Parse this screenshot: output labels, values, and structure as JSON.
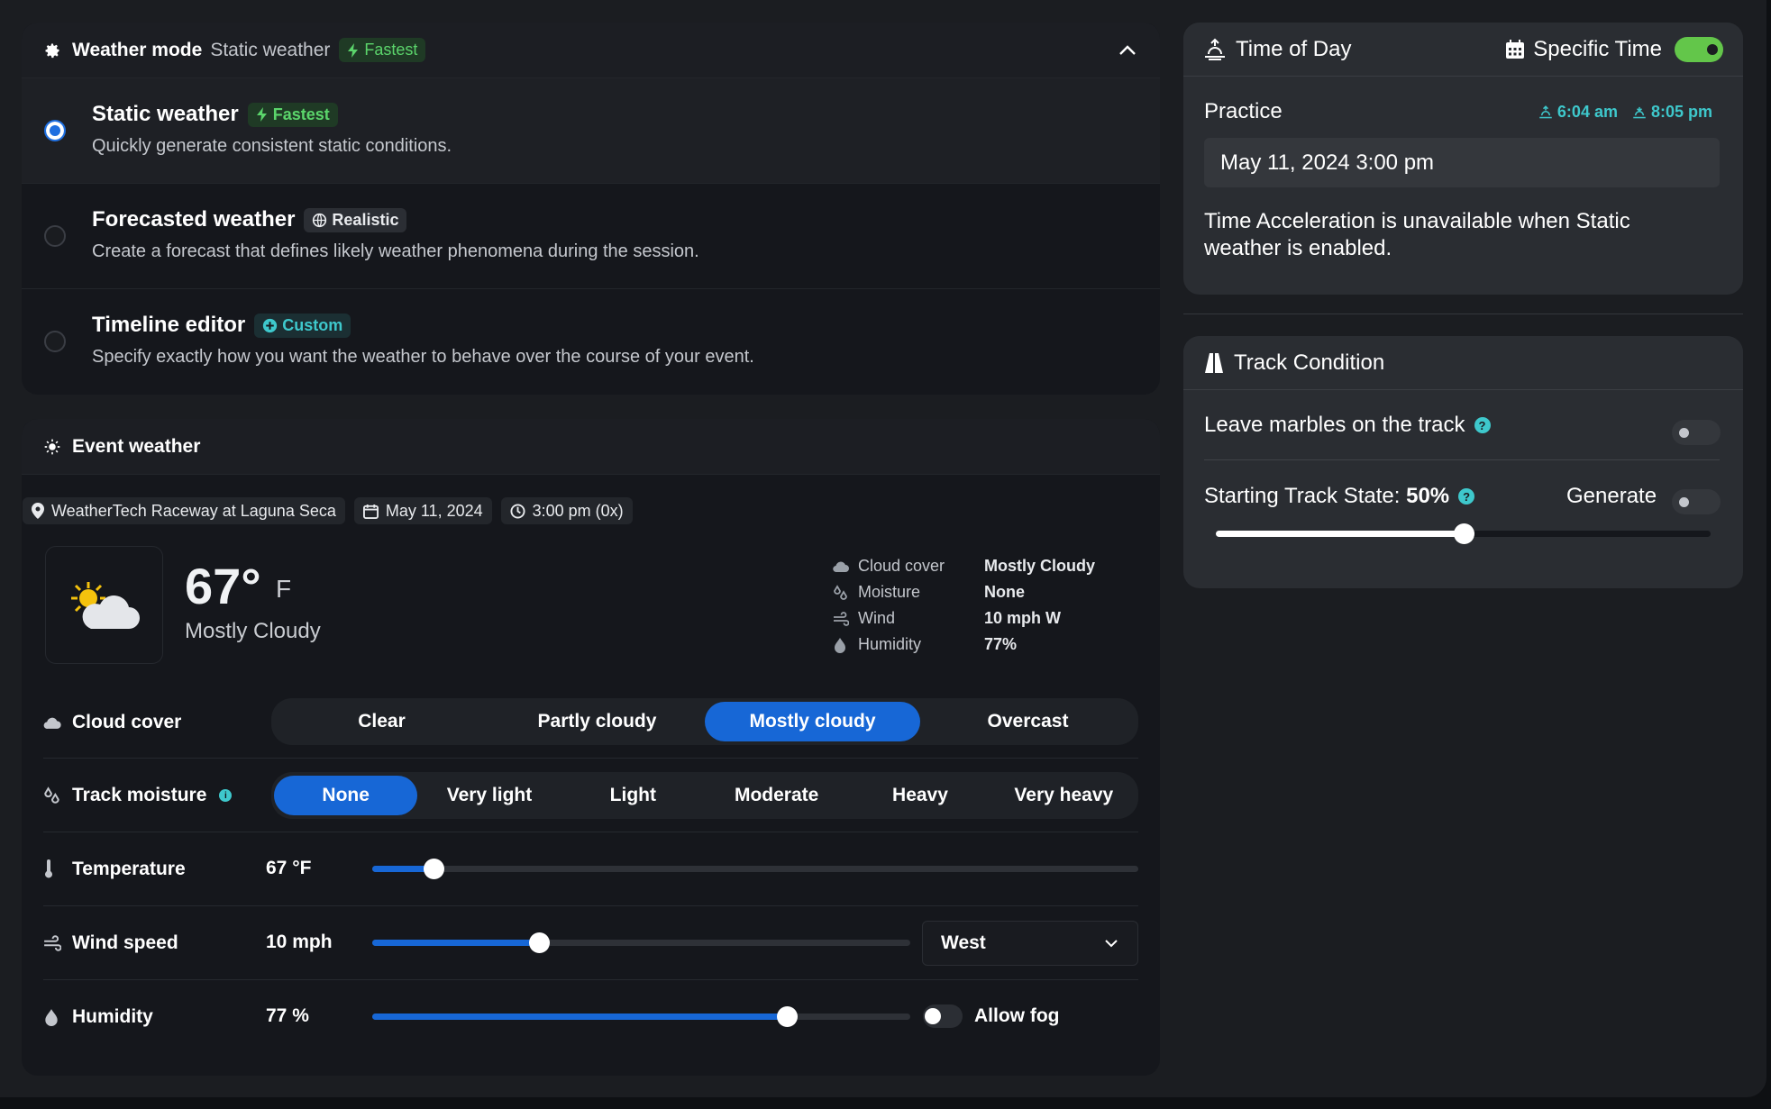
{
  "weather_mode": {
    "title": "Weather mode",
    "current": "Static weather",
    "current_badge": "Fastest",
    "options": [
      {
        "title": "Static weather",
        "badge": "Fastest",
        "desc": "Quickly generate consistent static conditions.",
        "selected": true
      },
      {
        "title": "Forecasted weather",
        "badge": "Realistic",
        "desc": "Create a forecast that defines likely weather phenomena during the session.",
        "selected": false
      },
      {
        "title": "Timeline editor",
        "badge": "Custom",
        "desc": "Specify exactly how you want the weather to behave over the course of your event.",
        "selected": false
      }
    ]
  },
  "event_weather": {
    "title": "Event weather",
    "location": "WeatherTech Raceway at Laguna Seca",
    "date": "May 11, 2024",
    "time": "3:00 pm (0x)",
    "temp": "67°",
    "temp_unit": "F",
    "condition": "Mostly Cloudy",
    "stats": [
      {
        "label": "Cloud cover",
        "value": "Mostly Cloudy",
        "icon": "cloud-icon"
      },
      {
        "label": "Moisture",
        "value": "None",
        "icon": "droplets-icon"
      },
      {
        "label": "Wind",
        "value": "10 mph W",
        "icon": "wind-icon"
      },
      {
        "label": "Humidity",
        "value": "77%",
        "icon": "humidity-drop-icon"
      }
    ],
    "cloud_cover": {
      "label": "Cloud cover",
      "options": [
        "Clear",
        "Partly cloudy",
        "Mostly cloudy",
        "Overcast"
      ],
      "selected": "Mostly cloudy"
    },
    "track_moisture": {
      "label": "Track moisture",
      "options": [
        "None",
        "Very light",
        "Light",
        "Moderate",
        "Heavy",
        "Very heavy"
      ],
      "selected": "None"
    },
    "temperature": {
      "label": "Temperature",
      "value": "67 °F",
      "level": 0.08
    },
    "wind": {
      "label": "Wind speed",
      "value": "10 mph",
      "level": 0.31,
      "direction": "West"
    },
    "humidity": {
      "label": "Humidity",
      "value": "77 %",
      "level": 0.77,
      "allow_fog_label": "Allow fog",
      "allow_fog": false
    }
  },
  "time_of_day": {
    "title": "Time of Day",
    "specific_time_label": "Specific Time",
    "specific_time_on": true,
    "session": "Practice",
    "sunrise": "6:04 am",
    "sunset": "8:05 pm",
    "datetime": "May 11, 2024 3:00 pm",
    "note": "Time Acceleration is unavailable when Static weather is enabled."
  },
  "track_condition": {
    "title": "Track Condition",
    "marbles_label": "Leave marbles on the track",
    "marbles_on": false,
    "starting_state_label": "Starting Track State:",
    "starting_state_value": "50%",
    "starting_state_level": 0.5,
    "generate_label": "Generate",
    "generate_on": false
  },
  "colors": {
    "accent": "#1767d6",
    "green": "#5bd46b",
    "teal": "#3ec8cc",
    "toggle_on": "#63c64a"
  }
}
